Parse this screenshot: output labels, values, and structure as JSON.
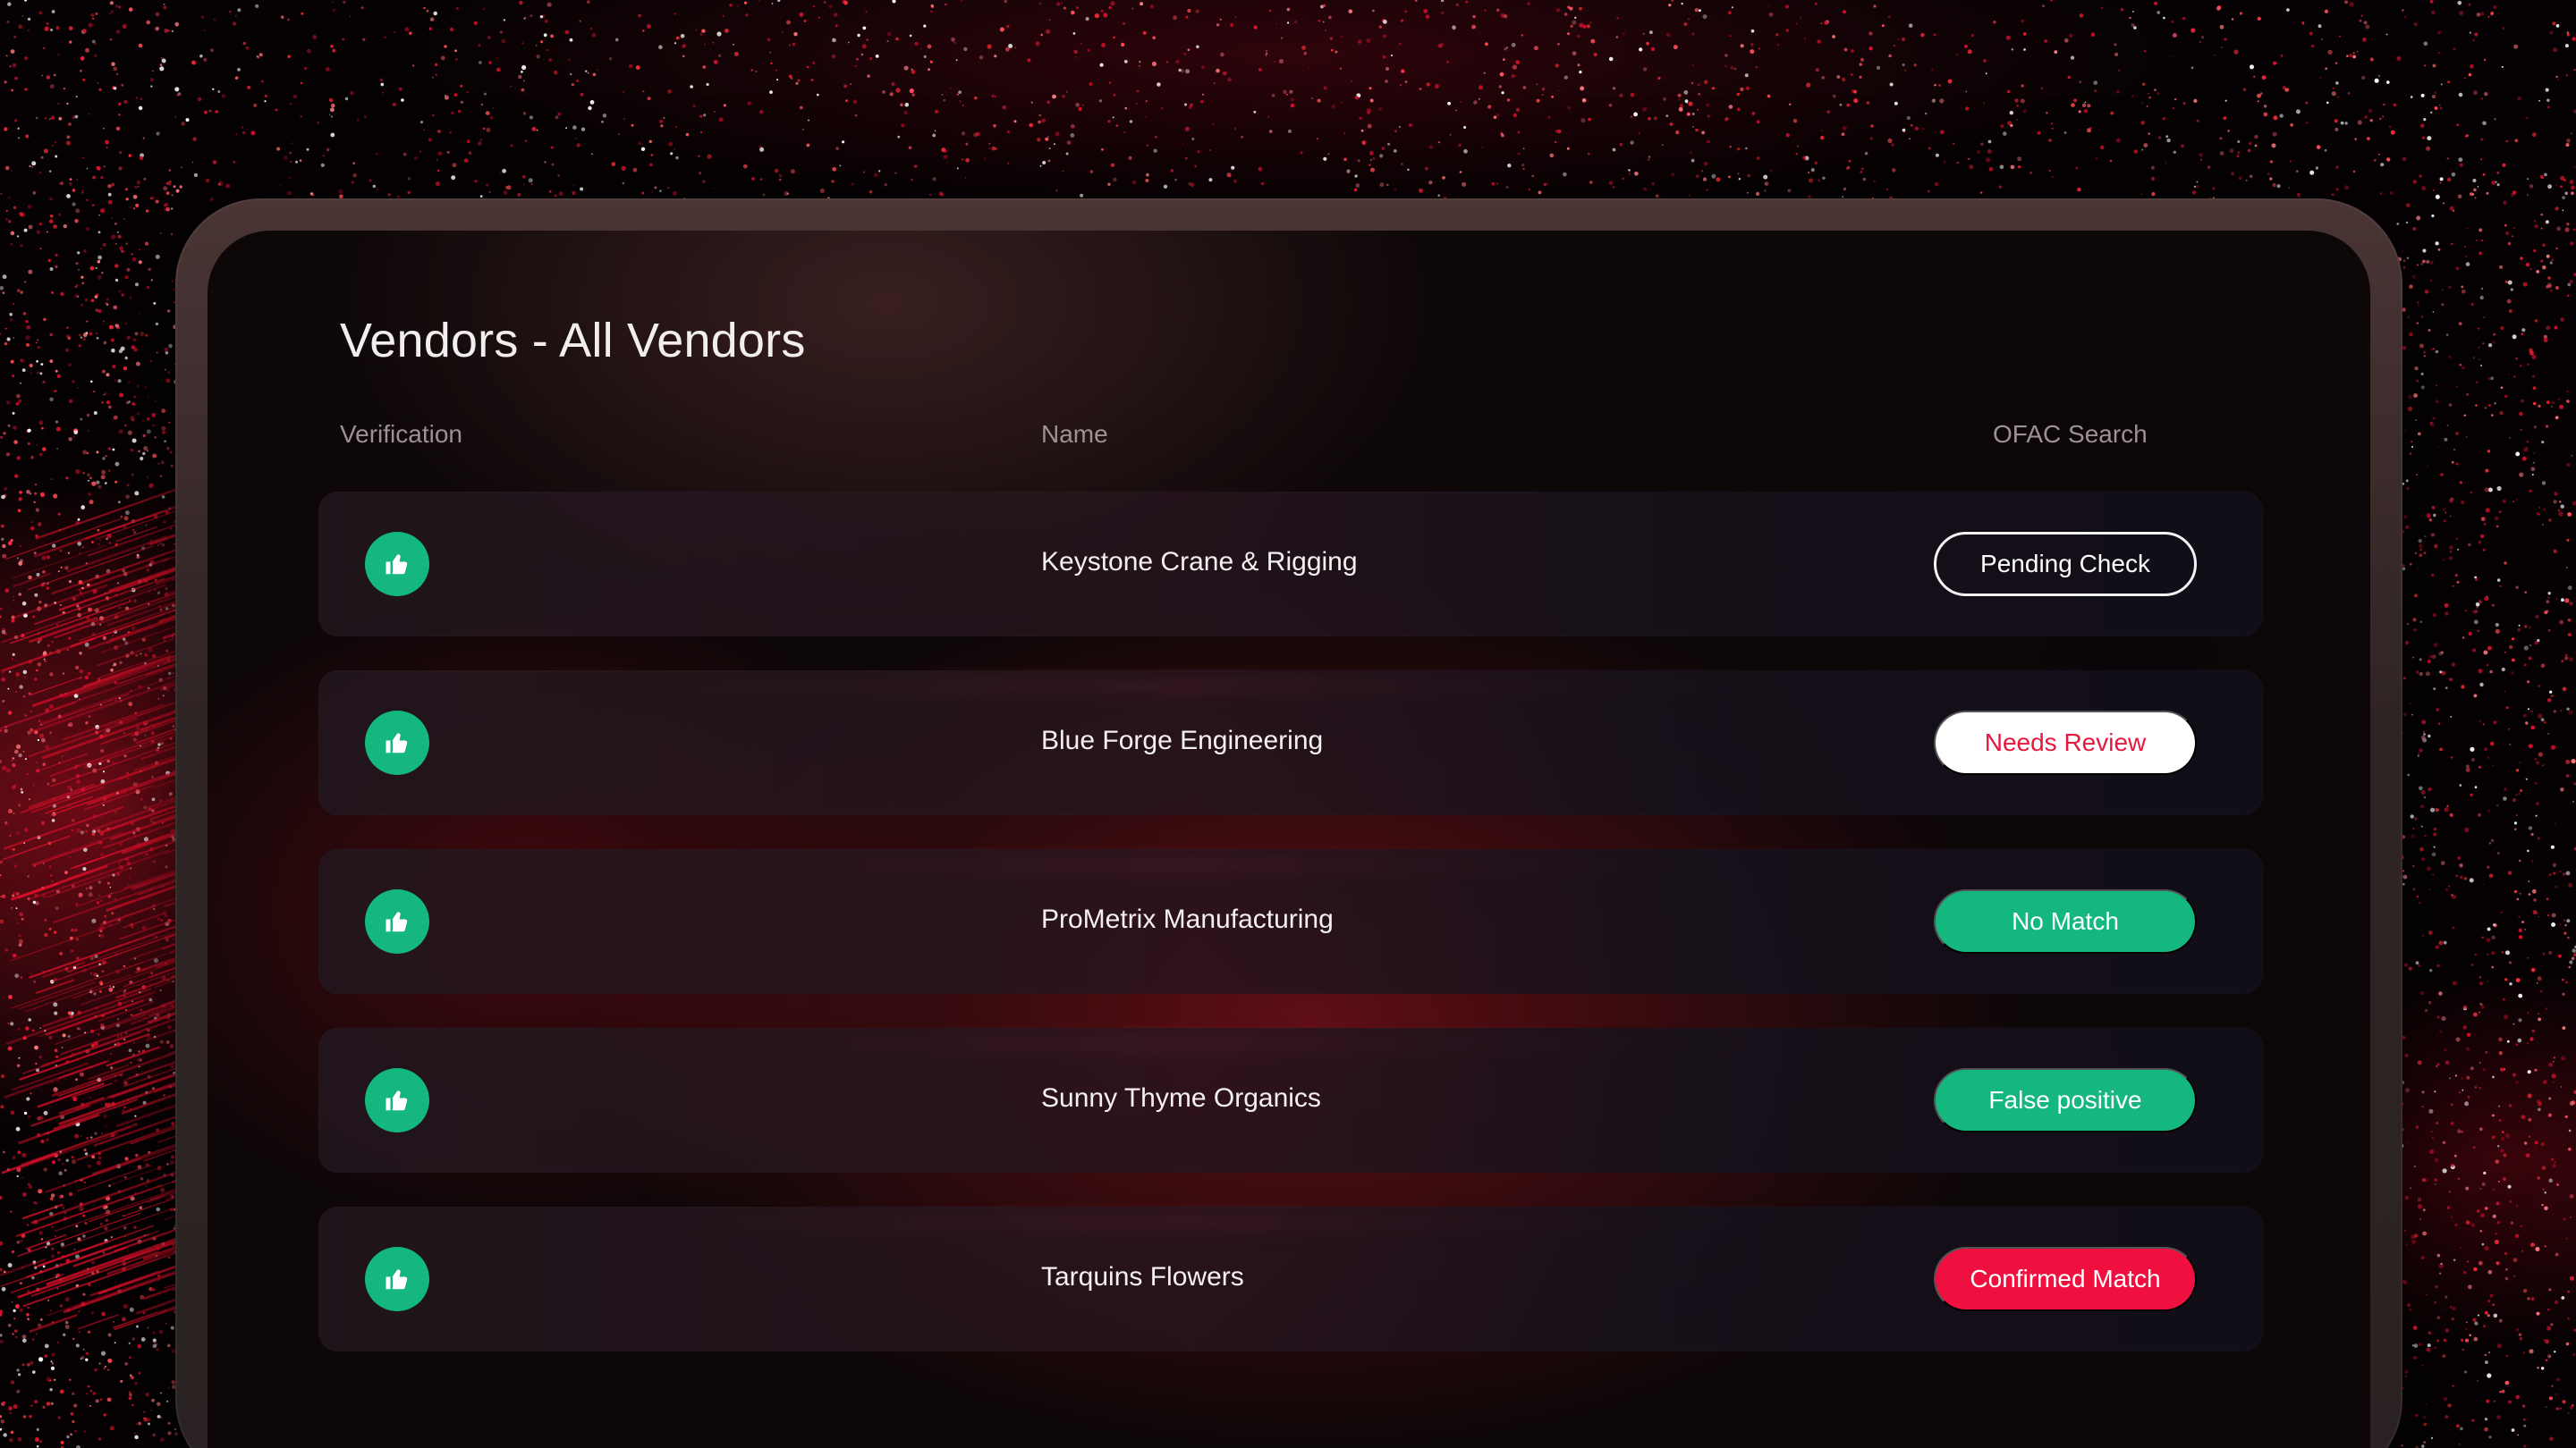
{
  "page": {
    "title": "Vendors - All Vendors"
  },
  "table": {
    "columns": {
      "verification": "Verification",
      "name": "Name",
      "ofac": "OFAC Search"
    },
    "rows": [
      {
        "name": "Keystone Crane & Rigging",
        "verification_icon": "thumbs-up-icon",
        "ofac_status": "Pending Check",
        "ofac_style": "outline"
      },
      {
        "name": "Blue Forge Engineering",
        "verification_icon": "thumbs-up-icon",
        "ofac_status": "Needs Review",
        "ofac_style": "white"
      },
      {
        "name": "ProMetrix Manufacturing",
        "verification_icon": "thumbs-up-icon",
        "ofac_status": "No Match",
        "ofac_style": "green"
      },
      {
        "name": "Sunny Thyme Organics",
        "verification_icon": "thumbs-up-icon",
        "ofac_status": "False positive",
        "ofac_style": "green"
      },
      {
        "name": "Tarquins Flowers",
        "verification_icon": "thumbs-up-icon",
        "ofac_status": "Confirmed Match",
        "ofac_style": "red"
      }
    ]
  },
  "colors": {
    "verified_green": "#14b87f",
    "match_red": "#f0103f",
    "review_text_red": "#e8173e",
    "background": "#060203"
  }
}
